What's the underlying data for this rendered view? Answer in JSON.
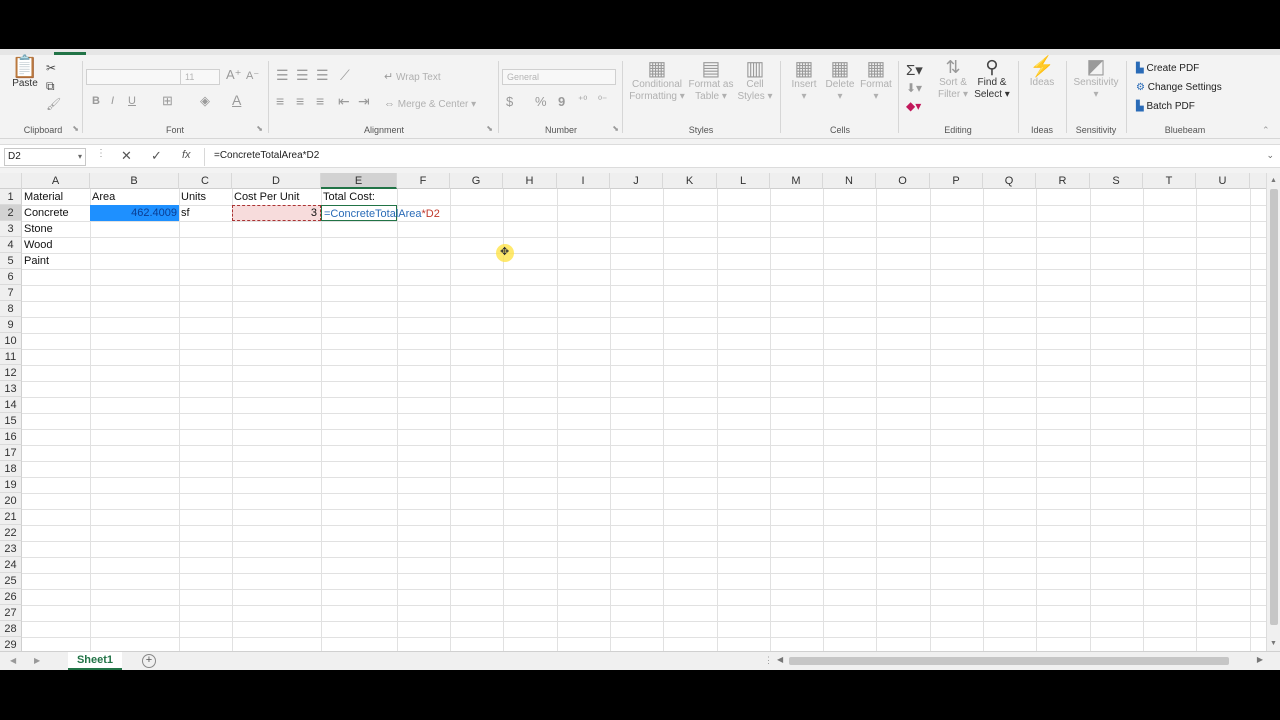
{
  "ribbon": {
    "clipboard": {
      "paste": "Paste",
      "label": "Clipboard"
    },
    "font": {
      "name_value": "",
      "size_value": "11",
      "label": "Font",
      "bold": "B",
      "italic": "I",
      "underline": "U",
      "grow": "A",
      "shrink": "A"
    },
    "alignment": {
      "wrap_text": "Wrap Text",
      "merge_center": "Merge & Center",
      "label": "Alignment"
    },
    "number": {
      "format_value": "General",
      "label": "Number",
      "currency": "$",
      "percent": "%",
      "comma": "9"
    },
    "styles": {
      "conditional_1": "Conditional",
      "conditional_2": "Formatting",
      "format_as_1": "Format as",
      "format_as_2": "Table",
      "cell_styles_1": "Cell",
      "cell_styles_2": "Styles",
      "label": "Styles"
    },
    "cells": {
      "insert": "Insert",
      "delete": "Delete",
      "format": "Format",
      "label": "Cells"
    },
    "editing": {
      "sort_1": "Sort &",
      "sort_2": "Filter",
      "find_1": "Find &",
      "find_2": "Select",
      "label": "Editing"
    },
    "ideas": {
      "ideas": "Ideas",
      "label": "Ideas"
    },
    "sensitivity": {
      "sensitivity": "Sensitivity",
      "label": "Sensitivity"
    },
    "bluebeam": {
      "create_pdf": "Create PDF",
      "change_settings": "Change Settings",
      "batch_pdf": "Batch PDF",
      "label": "Bluebeam"
    }
  },
  "formula_bar": {
    "name_box": "D2",
    "cancel": "✕",
    "enter": "✓",
    "fx": "fx",
    "formula": "=ConcreteTotalArea*D2"
  },
  "columns": [
    "A",
    "B",
    "C",
    "D",
    "E",
    "F",
    "G",
    "H",
    "I",
    "J",
    "K",
    "L",
    "M",
    "N",
    "O",
    "P",
    "Q",
    "R",
    "S",
    "T",
    "U"
  ],
  "rows": [
    "1",
    "2",
    "3",
    "4",
    "5",
    "6",
    "7",
    "8",
    "9",
    "10",
    "11",
    "12",
    "13",
    "14",
    "15",
    "16",
    "17",
    "18",
    "19",
    "20",
    "21",
    "22",
    "23",
    "24",
    "25",
    "26",
    "27",
    "28",
    "29"
  ],
  "cells": {
    "A1": "Material",
    "B1": "Area",
    "C1": "Units",
    "D1": "Cost Per Unit",
    "E1": "Total Cost:",
    "A2": "Concrete",
    "B2": "462.4009",
    "C2": "sf",
    "D2": "3",
    "E2_part1": "=ConcreteTotalArea",
    "E2_part2": "*D2",
    "A3": "Stone",
    "A4": "Wood",
    "A5": "Paint"
  },
  "sheet_tabs": {
    "active": "Sheet1"
  },
  "colors": {
    "accent": "#217346",
    "selection_fill": "#1e90ff",
    "reference_fill": "#f7dcdc",
    "range_ref_blue": "#2a6bb7",
    "cell_ref_red": "#c0392b"
  }
}
